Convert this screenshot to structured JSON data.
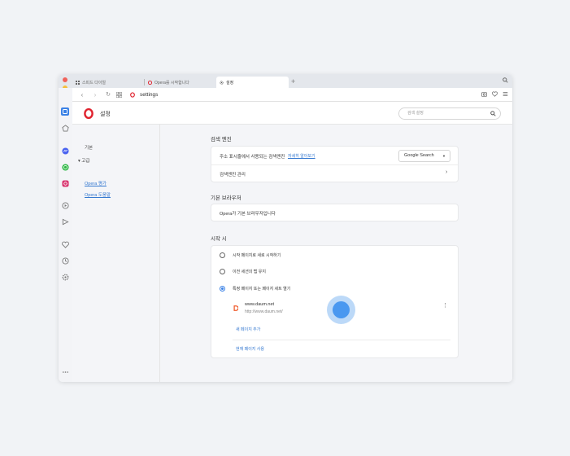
{
  "tabs": [
    {
      "label": "스피드 다이얼",
      "icon": "grid-icon"
    },
    {
      "label": "Opera를 시작합니다",
      "icon": "opera-icon"
    },
    {
      "label": "설정",
      "icon": "gear-icon",
      "active": true
    }
  ],
  "address": {
    "url": "settings"
  },
  "header": {
    "title": "설정",
    "search_placeholder": "검색 설정"
  },
  "leftnav": {
    "basic": "기본",
    "advanced": "▾  고급",
    "rate_opera": "Opera 평가",
    "opera_help": "Opera 도움말"
  },
  "search_engine": {
    "title": "검색 엔진",
    "address_bar_label": "주소 표시줄에서 사용되는 검색엔진",
    "learn_more": "자세히 알아보기",
    "selected": "Google Search",
    "manage": "검색엔진 관리"
  },
  "default_browser": {
    "title": "기본 브라우저",
    "status": "Opera가 기본 브라우저입니다"
  },
  "startup": {
    "title": "시작 시",
    "options": [
      "시작 페이지로 새로 시작하기",
      "이전 세션의 탭 유지",
      "특정 페이지 또는 페이지 세트 열기"
    ],
    "selected_index": 2,
    "page": {
      "title": "www.daum.net",
      "url": "http://www.daum.net/"
    },
    "add_page": "새 페이지 추가",
    "use_current": "현재 페이지 사용"
  },
  "colors": {
    "accent": "#3b82e6",
    "opera_red": "#e0222e"
  }
}
